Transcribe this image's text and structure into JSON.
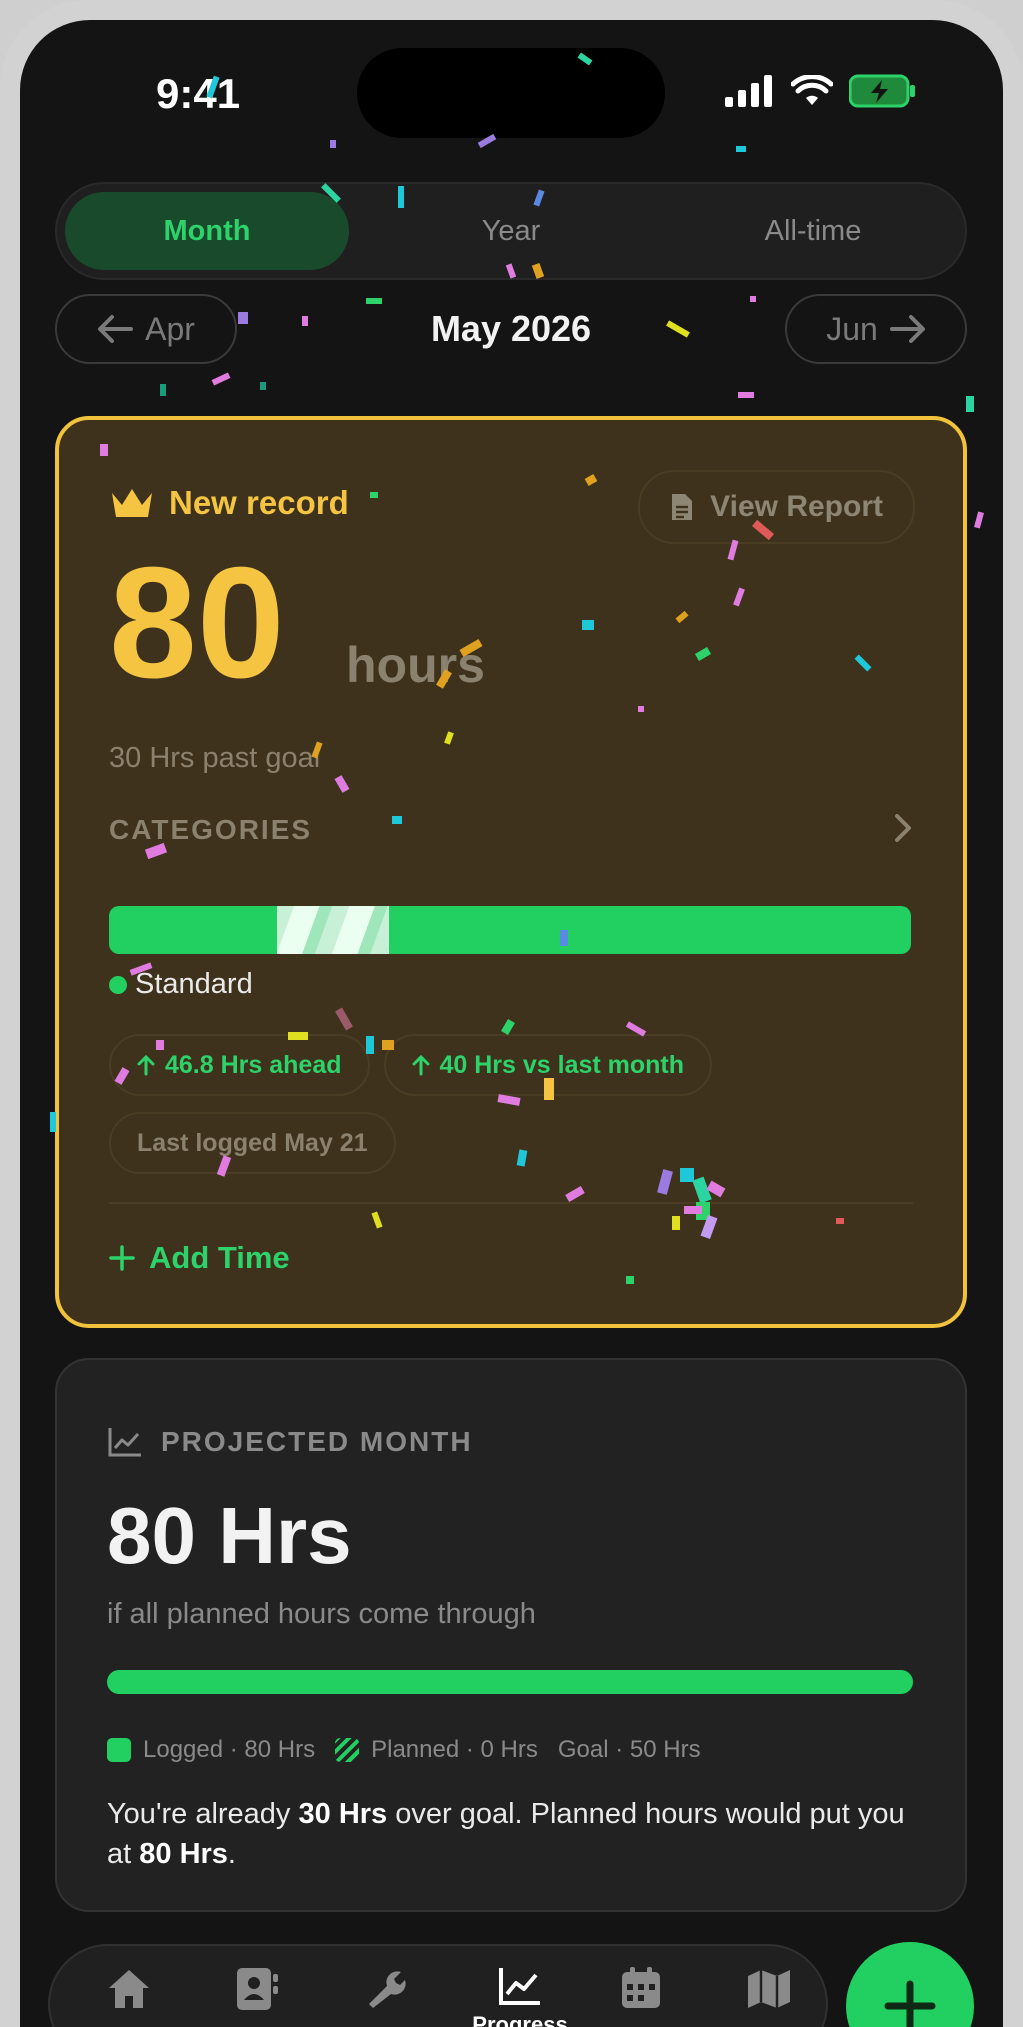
{
  "status": {
    "time": "9:41"
  },
  "segments": [
    {
      "label": "Month",
      "active": true
    },
    {
      "label": "Year",
      "active": false
    },
    {
      "label": "All-time",
      "active": false
    }
  ],
  "month_nav": {
    "prev": "Apr",
    "current": "May 2026",
    "next": "Jun"
  },
  "record": {
    "badge_title": "New record",
    "view_report": "View Report",
    "hours_value": "80",
    "hours_unit": "hours",
    "past_goal": "30 Hrs past goal",
    "categories_label": "CATEGORIES",
    "category_name": "Standard",
    "pill_ahead": "46.8 Hrs ahead",
    "pill_vs_last": "40 Hrs vs last month",
    "last_logged": "Last logged May 21",
    "add_time": "Add Time"
  },
  "projected": {
    "title": "PROJECTED MONTH",
    "value": "80 Hrs",
    "subtitle": "if all planned hours come through",
    "progress_fraction": 1.0,
    "legend_logged": "Logged · 80 Hrs",
    "legend_planned": "Planned · 0 Hrs",
    "legend_goal": "Goal · 50 Hrs",
    "note_1": "You're already ",
    "note_bold_1": "30 Hrs",
    "note_2": " over goal. Planned hours would put you at ",
    "note_bold_2": "80 Hrs",
    "note_3": "."
  },
  "tabbar": {
    "items": [
      {
        "icon": "home-icon",
        "label": ""
      },
      {
        "icon": "contacts-icon",
        "label": ""
      },
      {
        "icon": "wrench-icon",
        "label": ""
      },
      {
        "icon": "chart-icon",
        "label": "Progress"
      },
      {
        "icon": "calendar-icon",
        "label": ""
      },
      {
        "icon": "map-icon",
        "label": ""
      }
    ]
  },
  "colors": {
    "accent_green": "#21d061",
    "record_gold": "#f5c542",
    "card_bg": "#3e321c"
  }
}
